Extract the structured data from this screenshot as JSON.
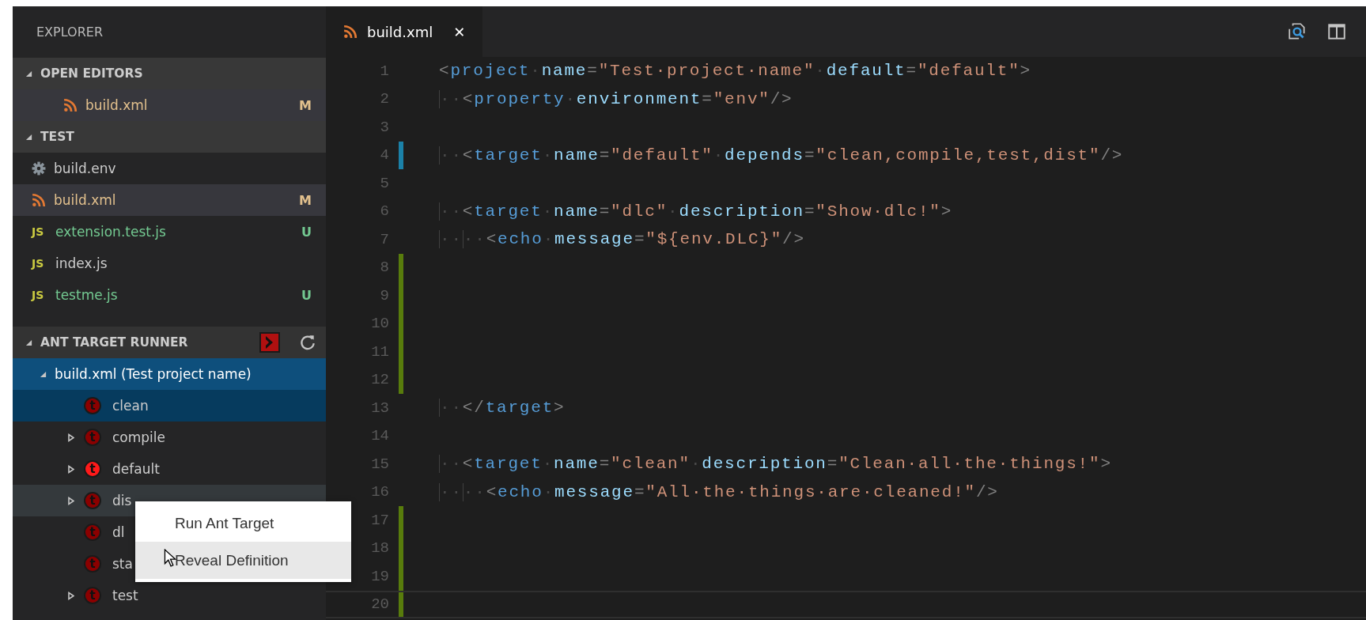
{
  "sidebar": {
    "title": "EXPLORER",
    "open_editors": {
      "title": "OPEN EDITORS",
      "expanded": true,
      "items": [
        {
          "name": "build.xml",
          "kind": "rss",
          "status": "M",
          "color": "#e2c08d",
          "selected": true
        }
      ]
    },
    "workspace": {
      "title": "TEST",
      "expanded": true,
      "items": [
        {
          "name": "build.env",
          "kind": "gear",
          "color": "#cccccc",
          "selected": false
        },
        {
          "name": "build.xml",
          "kind": "rss",
          "status": "M",
          "color": "#e2c08d",
          "selected": true
        },
        {
          "name": "extension.test.js",
          "kind": "js",
          "icon_label": "JS",
          "status": "U",
          "color": "#73c991",
          "selected": false
        },
        {
          "name": "index.js",
          "kind": "js",
          "icon_label": "JS",
          "color": "#cccccc",
          "selected": false
        },
        {
          "name": "testme.js",
          "kind": "js",
          "icon_label": "JS",
          "status": "U",
          "color": "#73c991",
          "selected": false
        }
      ]
    },
    "ant_runner": {
      "title": "ANT TARGET RUNNER",
      "expanded": true,
      "root": {
        "label": "build.xml (Test project name)",
        "expanded": true,
        "selected": true,
        "children": [
          {
            "label": "clean",
            "badge": "t",
            "color": "#8b0000",
            "has_children": false,
            "selected": true,
            "hovered": false
          },
          {
            "label": "compile",
            "badge": "t",
            "color": "#8b0000",
            "has_children": true,
            "selected": false,
            "hovered": false
          },
          {
            "label": "default",
            "badge": "t",
            "color": "#ff1a1a",
            "has_children": true,
            "selected": false,
            "hovered": false
          },
          {
            "label": "dis",
            "badge": "t",
            "color": "#8b0000",
            "has_children": true,
            "selected": false,
            "hovered": true
          },
          {
            "label": "dl",
            "badge": "t",
            "color": "#8b0000",
            "has_children": false,
            "selected": false,
            "hovered": false
          },
          {
            "label": "sta",
            "badge": "t",
            "color": "#8b0000",
            "has_children": false,
            "selected": false,
            "hovered": false
          },
          {
            "label": "test",
            "badge": "t",
            "color": "#8b0000",
            "has_children": true,
            "selected": false,
            "hovered": false
          }
        ]
      }
    }
  },
  "context_menu": {
    "items": [
      {
        "label": "Run Ant Target",
        "selected": false
      },
      {
        "label": "Reveal Definition",
        "selected": true
      }
    ]
  },
  "tabs": [
    {
      "label": "build.xml",
      "close": "✕",
      "selected": true
    }
  ],
  "editor": {
    "lines": [
      {
        "number": "1",
        "tokens": [
          {
            "kind": "p",
            "t": "<"
          },
          {
            "kind": "tag",
            "t": "project"
          },
          {
            "kind": "ws",
            "t": "·"
          },
          {
            "kind": "attr",
            "t": "name"
          },
          {
            "kind": "p",
            "t": "="
          },
          {
            "kind": "str",
            "t": "\"Test·project·name\""
          },
          {
            "kind": "ws",
            "t": "·"
          },
          {
            "kind": "attr",
            "t": "default"
          },
          {
            "kind": "p",
            "t": "="
          },
          {
            "kind": "str",
            "t": "\"default\""
          },
          {
            "kind": "p",
            "t": ">"
          }
        ]
      },
      {
        "number": "2",
        "tokens": [
          {
            "kind": "indent",
            "t": "··"
          },
          {
            "kind": "p",
            "t": "<"
          },
          {
            "kind": "tag",
            "t": "property"
          },
          {
            "kind": "ws",
            "t": "·"
          },
          {
            "kind": "attr",
            "t": "environment"
          },
          {
            "kind": "p",
            "t": "="
          },
          {
            "kind": "str",
            "t": "\"env\""
          },
          {
            "kind": "p",
            "t": "/>"
          }
        ]
      },
      {
        "number": "3"
      },
      {
        "number": "4",
        "color": "#1b81a8",
        "tokens": [
          {
            "kind": "indent",
            "t": "··"
          },
          {
            "kind": "p",
            "t": "<"
          },
          {
            "kind": "tag",
            "t": "target"
          },
          {
            "kind": "ws",
            "t": "·"
          },
          {
            "kind": "attr",
            "t": "name"
          },
          {
            "kind": "p",
            "t": "="
          },
          {
            "kind": "str",
            "t": "\"default\""
          },
          {
            "kind": "ws",
            "t": "·"
          },
          {
            "kind": "attr",
            "t": "depends"
          },
          {
            "kind": "p",
            "t": "="
          },
          {
            "kind": "str",
            "t": "\"clean,compile,test,dist\""
          },
          {
            "kind": "p",
            "t": "/>"
          }
        ]
      },
      {
        "number": "5"
      },
      {
        "number": "6",
        "tokens": [
          {
            "kind": "indent",
            "t": "··"
          },
          {
            "kind": "p",
            "t": "<"
          },
          {
            "kind": "tag",
            "t": "target"
          },
          {
            "kind": "ws",
            "t": "·"
          },
          {
            "kind": "attr",
            "t": "name"
          },
          {
            "kind": "p",
            "t": "="
          },
          {
            "kind": "str",
            "t": "\"dlc\""
          },
          {
            "kind": "ws",
            "t": "·"
          },
          {
            "kind": "attr",
            "t": "description"
          },
          {
            "kind": "p",
            "t": "="
          },
          {
            "kind": "str",
            "t": "\"Show·dlc!\""
          },
          {
            "kind": "p",
            "t": ">"
          }
        ]
      },
      {
        "number": "7",
        "tokens": [
          {
            "kind": "indent",
            "t": "··"
          },
          {
            "kind": "indent",
            "t": "··"
          },
          {
            "kind": "p",
            "t": "<"
          },
          {
            "kind": "tag",
            "t": "echo"
          },
          {
            "kind": "ws",
            "t": "·"
          },
          {
            "kind": "attr",
            "t": "message"
          },
          {
            "kind": "p",
            "t": "="
          },
          {
            "kind": "str",
            "t": "\"${env.DLC}\""
          },
          {
            "kind": "p",
            "t": "/>"
          }
        ]
      },
      {
        "number": "8",
        "color": "#587c0c"
      },
      {
        "number": "9",
        "color": "#587c0c"
      },
      {
        "number": "10",
        "color": "#587c0c"
      },
      {
        "number": "11",
        "color": "#587c0c"
      },
      {
        "number": "12",
        "color": "#587c0c"
      },
      {
        "number": "13",
        "tokens": [
          {
            "kind": "indent",
            "t": "··"
          },
          {
            "kind": "p",
            "t": "</"
          },
          {
            "kind": "tag",
            "t": "target"
          },
          {
            "kind": "p",
            "t": ">"
          }
        ]
      },
      {
        "number": "14"
      },
      {
        "number": "15",
        "tokens": [
          {
            "kind": "indent",
            "t": "··"
          },
          {
            "kind": "p",
            "t": "<"
          },
          {
            "kind": "tag",
            "t": "target"
          },
          {
            "kind": "ws",
            "t": "·"
          },
          {
            "kind": "attr",
            "t": "name"
          },
          {
            "kind": "p",
            "t": "="
          },
          {
            "kind": "str",
            "t": "\"clean\""
          },
          {
            "kind": "ws",
            "t": "·"
          },
          {
            "kind": "attr",
            "t": "description"
          },
          {
            "kind": "p",
            "t": "="
          },
          {
            "kind": "str",
            "t": "\"Clean·all·the·things!\""
          },
          {
            "kind": "p",
            "t": ">"
          }
        ]
      },
      {
        "number": "16",
        "tokens": [
          {
            "kind": "indent",
            "t": "··"
          },
          {
            "kind": "indent",
            "t": "··"
          },
          {
            "kind": "p",
            "t": "<"
          },
          {
            "kind": "tag",
            "t": "echo"
          },
          {
            "kind": "ws",
            "t": "·"
          },
          {
            "kind": "attr",
            "t": "message"
          },
          {
            "kind": "p",
            "t": "="
          },
          {
            "kind": "str",
            "t": "\"All·the·things·are·cleaned!\""
          },
          {
            "kind": "p",
            "t": "/>"
          }
        ]
      },
      {
        "number": "17",
        "color": "#587c0c"
      },
      {
        "number": "18",
        "color": "#587c0c"
      },
      {
        "number": "19",
        "color": "#587c0c"
      },
      {
        "number": "20",
        "color": "#587c0c",
        "current": true
      }
    ]
  }
}
